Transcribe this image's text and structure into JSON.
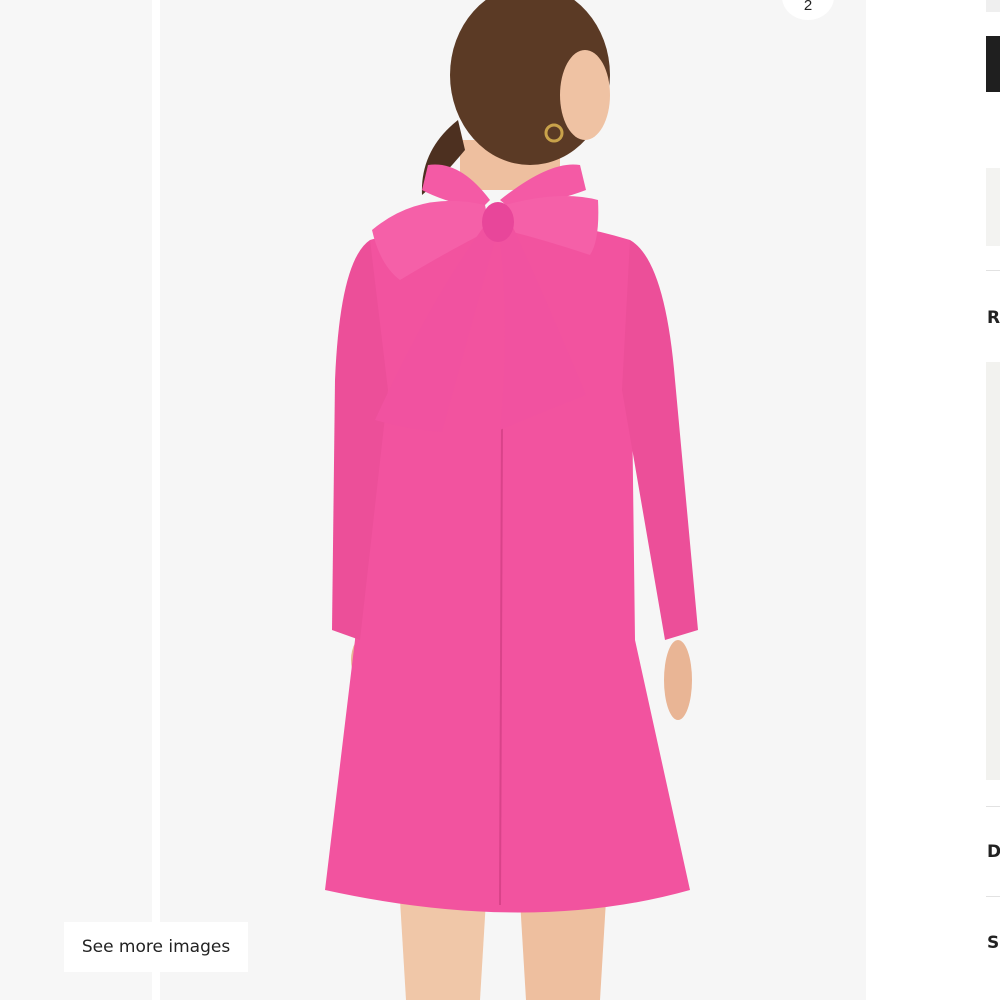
{
  "gallery": {
    "see_more_label": "See more images",
    "counter": "2",
    "image_alt": "Model wearing a pink long-sleeve shift dress with a large bow at the back of the neck"
  },
  "right_panel": {
    "section_letters": [
      "R",
      "D",
      "S"
    ]
  },
  "colors": {
    "dress_pink": "#f2539f",
    "background_grey": "#f6f6f6",
    "button_dark": "#1f1f1f"
  }
}
